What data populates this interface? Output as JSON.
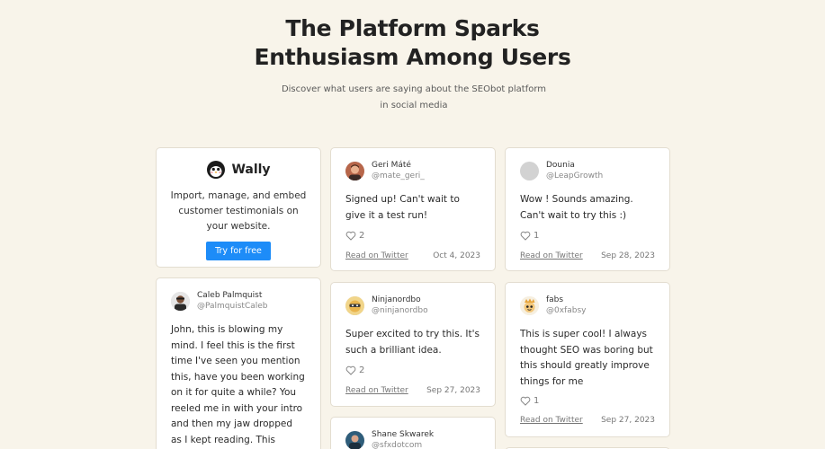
{
  "header": {
    "title_line1": "The Platform Sparks",
    "title_line2": "Enthusiasm Among Users",
    "subtitle": "Discover what users are saying about the SEObot platform in social media"
  },
  "widget": {
    "brand": "Wally",
    "description": "Import, manage, and embed customer testimonials on your website.",
    "cta": "Try for free",
    "cta_color": "#1d8cf8"
  },
  "testimonials": [
    {
      "name": "Geri Máté",
      "handle": "@mate_geri_",
      "text": "Signed up! Can't wait to give it a test run!",
      "likes": "2",
      "link": "Read on Twitter",
      "date": "Oct 4, 2023"
    },
    {
      "name": "Dounia",
      "handle": "@LeapGrowth",
      "text": "Wow ! Sounds amazing. Can't wait to try this :)",
      "likes": "1",
      "link": "Read on Twitter",
      "date": "Sep 28, 2023"
    },
    {
      "name": "Caleb Palmquist",
      "handle": "@PalmquistCaleb",
      "text": "John, this is blowing my mind. I feel this is the first time I've seen you mention this, have you been working on it for quite a while? You reeled me in with your intro and then my jaw dropped as I kept reading. This sound huge."
    },
    {
      "name": "Ninjanordbo",
      "handle": "@ninjanordbo",
      "text": "Super excited to try this. It's such a brilliant idea.",
      "likes": "2",
      "link": "Read on Twitter",
      "date": "Sep 27, 2023"
    },
    {
      "name": "fabs",
      "handle": "@0xfabsy",
      "text": "This is super cool! I always thought SEO was boring but this should greatly improve things for me",
      "likes": "1",
      "link": "Read on Twitter",
      "date": "Sep 27, 2023"
    },
    {
      "name": "Shane Skwarek",
      "handle": "@sfxdotcom"
    }
  ]
}
